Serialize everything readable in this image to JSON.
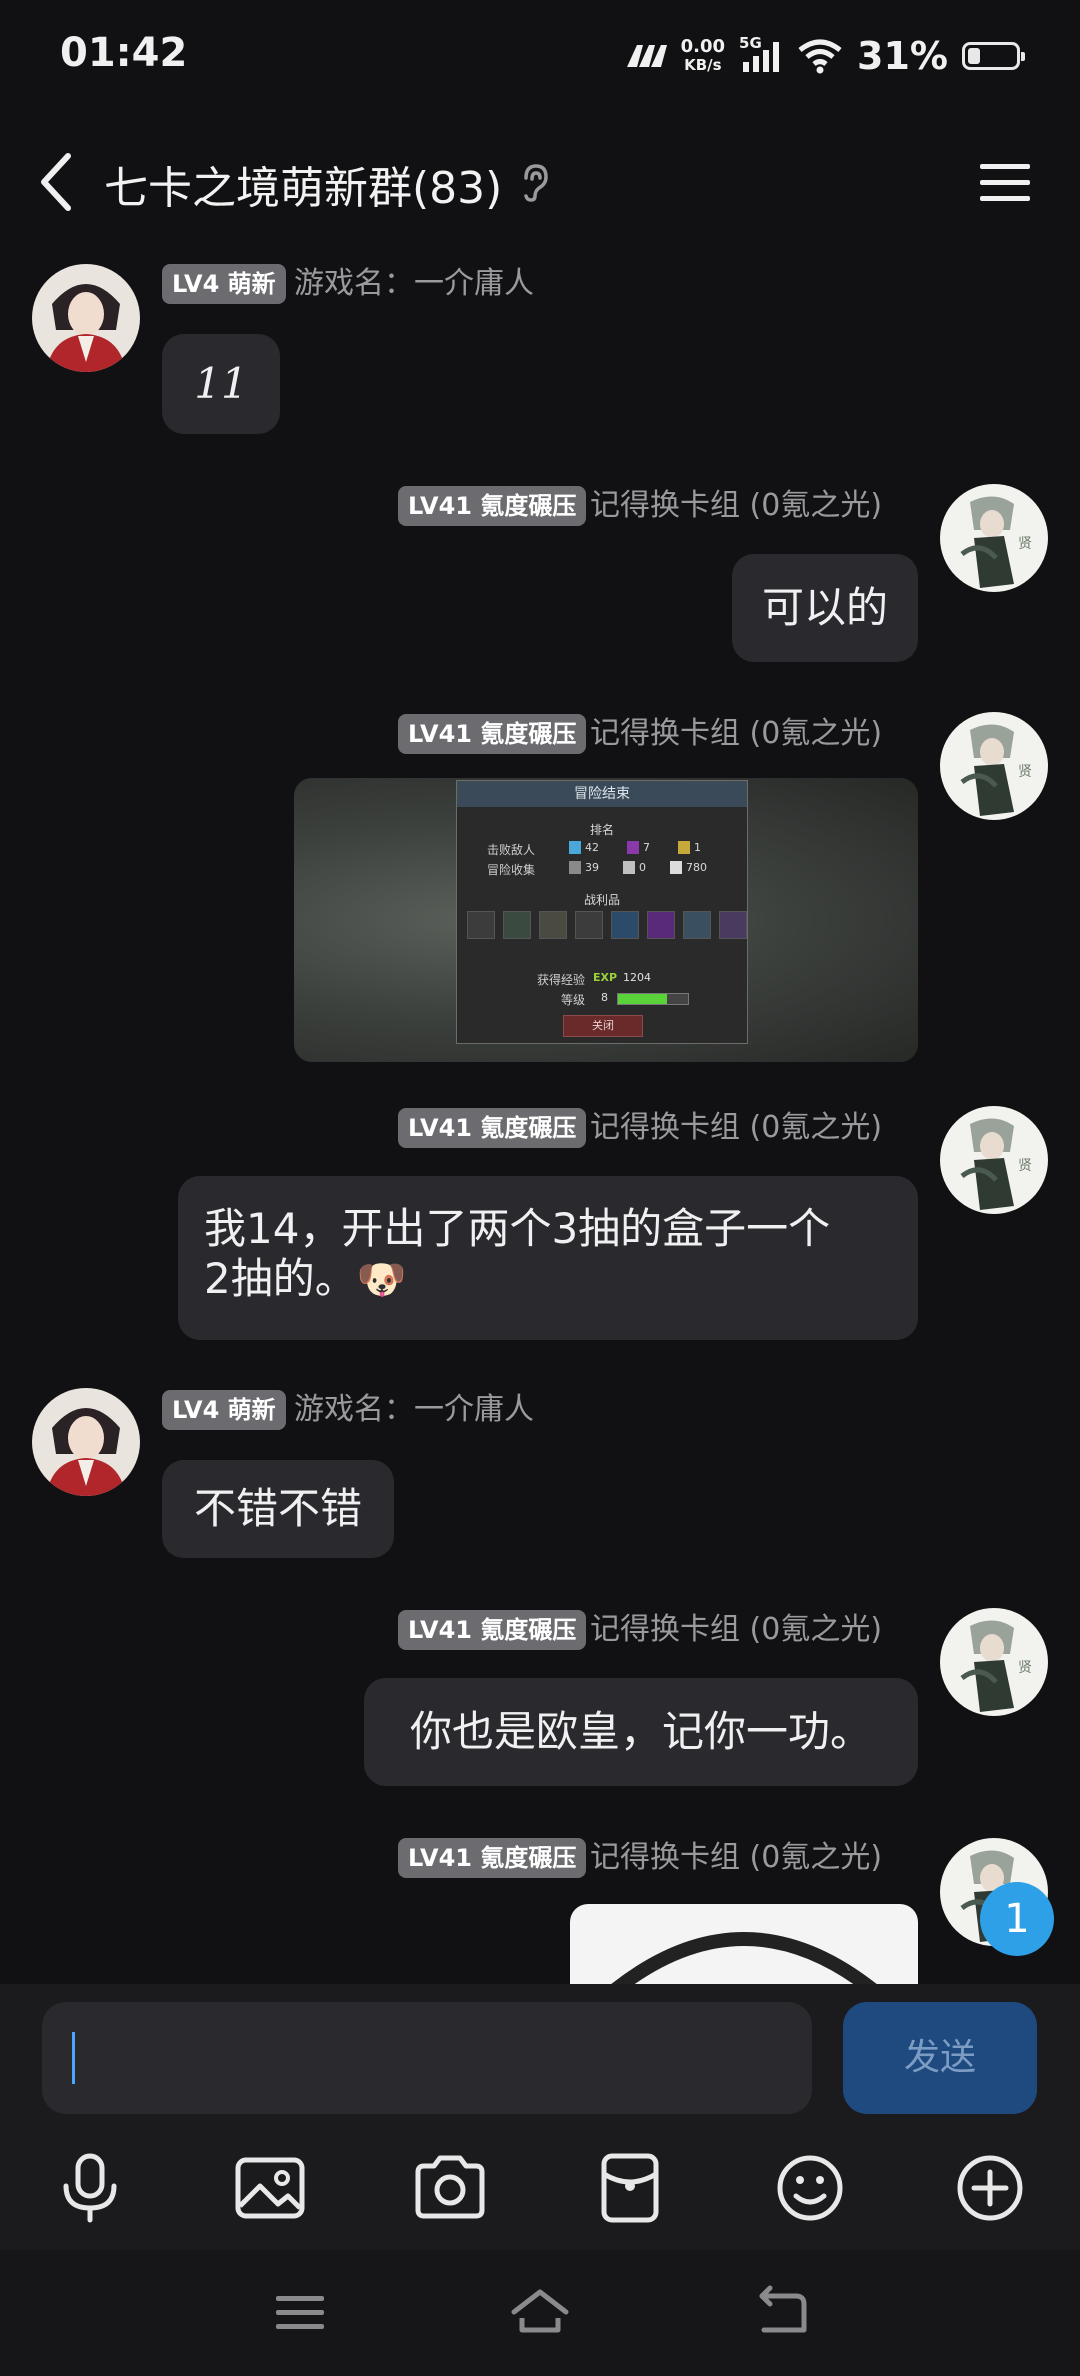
{
  "status_bar": {
    "time": "01:42",
    "speed_value": "0.00",
    "speed_unit": "KB/s",
    "network": "5G",
    "battery": "31%"
  },
  "header": {
    "title": "七卡之境萌新群(83)"
  },
  "messages": [
    {
      "sender_badge": "LV4 萌新",
      "sender_name": "游戏名：一介庸人",
      "text": "11"
    },
    {
      "sender_badge": "LV41 氪度碾压",
      "sender_name": "记得换卡组 (0氪之光)",
      "text": "可以的"
    },
    {
      "sender_badge": "LV41 氪度碾压",
      "sender_name": "记得换卡组 (0氪之光)",
      "image": {
        "title": "冒险结束",
        "rank_label": "排名",
        "defeated_label": "击败敌人",
        "defeated_values": [
          "42",
          "7",
          "1"
        ],
        "collect_label": "冒险收集",
        "collect_values": [
          "39",
          "0",
          "780"
        ],
        "loot_label": "战利品",
        "exp_label": "获得经验",
        "exp_badge": "EXP",
        "exp_value": "1204",
        "level_label": "等级",
        "level_value": "8",
        "level_progress": 0.7,
        "close_label": "关闭"
      }
    },
    {
      "sender_badge": "LV41 氪度碾压",
      "sender_name": "记得换卡组 (0氪之光)",
      "text_line1": "我14，开出了两个3抽的盒子一个",
      "text_line2": "2抽的。",
      "emoji": "🐶"
    },
    {
      "sender_badge": "LV4 萌新",
      "sender_name": "游戏名：一介庸人",
      "text": "不错不错"
    },
    {
      "sender_badge": "LV41 氪度碾压",
      "sender_name": "记得换卡组 (0氪之光)",
      "text": "你也是欧皇，记你一功。"
    },
    {
      "sender_badge": "LV41 氪度碾压",
      "sender_name": "记得换卡组 (0氪之光)"
    }
  ],
  "unread_count": "1",
  "input": {
    "value": "",
    "send_label": "发送"
  },
  "icons": {
    "back": "back-arrow-icon",
    "listen": "ear-icon",
    "menu": "menu-icon",
    "mic": "microphone-icon",
    "image": "image-icon",
    "camera": "camera-icon",
    "redpacket": "red-packet-icon",
    "emoji": "emoji-icon",
    "plus": "plus-icon"
  },
  "colors": {
    "background": "#111113",
    "bubble": "#2a2a2e",
    "badge": "#6c6c70",
    "send": "#1f4a80",
    "accent": "#2ea0e8"
  }
}
